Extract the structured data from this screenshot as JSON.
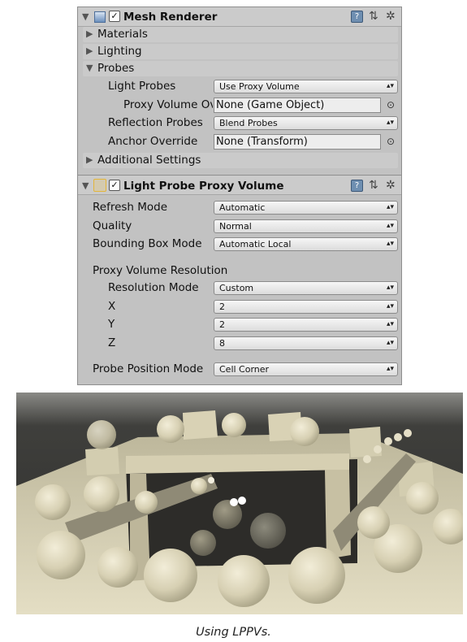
{
  "mesh_renderer": {
    "title": "Mesh Renderer",
    "enabled_check": "✓",
    "icons": [
      "mesh-renderer-icon",
      "help-icon",
      "preset-icon",
      "gear-icon"
    ],
    "sections": [
      {
        "label": "Materials",
        "arrow": "▶"
      },
      {
        "label": "Lighting",
        "arrow": "▶"
      },
      {
        "label": "Probes",
        "arrow": "▼"
      }
    ],
    "light_probes": {
      "label": "Light Probes",
      "value": "Use Proxy Volume"
    },
    "proxy_volume_override": {
      "label": "Proxy Volume Ov",
      "value": "None (Game Object)"
    },
    "reflection_probes": {
      "label": "Reflection Probes",
      "value": "Blend Probes"
    },
    "anchor_override": {
      "label": "Anchor Override",
      "value": "None (Transform)"
    },
    "additional_settings": {
      "label": "Additional Settings",
      "arrow": "▶"
    }
  },
  "lppv": {
    "title": "Light Probe Proxy Volume",
    "enabled_check": "✓",
    "icons": [
      "lppv-icon",
      "help-icon",
      "preset-icon",
      "gear-icon"
    ],
    "refresh_mode": {
      "label": "Refresh Mode",
      "value": "Automatic"
    },
    "quality": {
      "label": "Quality",
      "value": "Normal"
    },
    "bounding_box_mode": {
      "label": "Bounding Box Mode",
      "value": "Automatic Local"
    },
    "resolution_header": "Proxy Volume Resolution",
    "resolution_mode": {
      "label": "Resolution Mode",
      "value": "Custom"
    },
    "x": {
      "label": "X",
      "value": "2"
    },
    "y": {
      "label": "Y",
      "value": "2"
    },
    "z": {
      "label": "Z",
      "value": "8"
    },
    "probe_position_mode": {
      "label": "Probe Position Mode",
      "value": "Cell Corner"
    }
  },
  "glyphs": {
    "collapse": "▼",
    "dropdown": "▴▾",
    "picker": "⊙",
    "help": "?",
    "preset": "⇅",
    "gear": "✲"
  },
  "colors": {
    "inspector_bg": "#c2c2c2",
    "scene_floor": "#cfc8ab",
    "scene_sky": "#3a3a38"
  },
  "caption": "Using LPPVs."
}
